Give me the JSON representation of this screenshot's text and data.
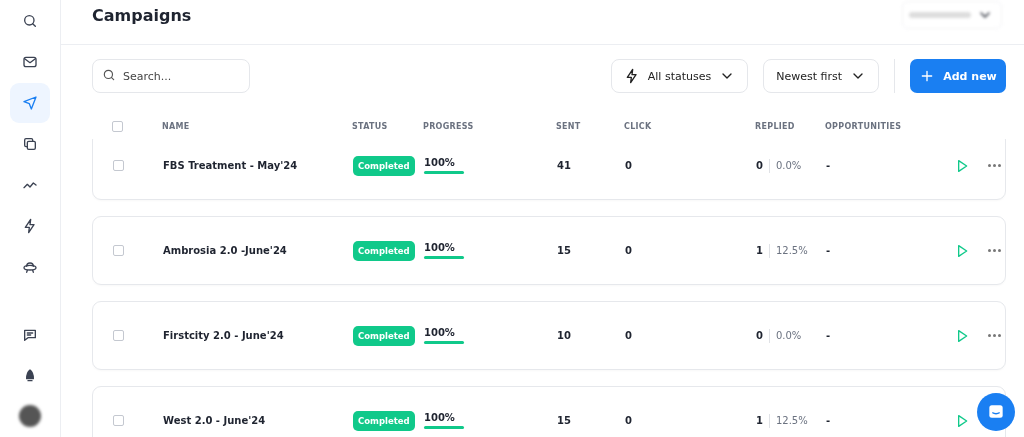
{
  "sidebar": {
    "items": [
      {
        "selected": false
      },
      {
        "selected": false
      },
      {
        "selected": true
      },
      {
        "selected": false
      },
      {
        "selected": false
      },
      {
        "selected": false
      },
      {
        "selected": false
      }
    ]
  },
  "header": {
    "title": "Campaigns"
  },
  "toolbar": {
    "search": {
      "placeholder": "Search..."
    },
    "status_filter": "All statuses",
    "sort": "Newest first",
    "add_button": "Add new"
  },
  "table": {
    "all_checked": false,
    "columns": [
      "NAME",
      "STATUS",
      "PROGRESS",
      "SENT",
      "CLICK",
      "REPLIED",
      "OPPORTUNITIES"
    ],
    "rows": [
      {
        "name": "FBS Treatment - May'24",
        "status": "Completed",
        "progress": "100%",
        "level": 1,
        "sent": "41",
        "click": "0",
        "replied": "0",
        "replied_rate": "0.0%",
        "opportunities": "-",
        "checked": false
      },
      {
        "name": "Ambrosia 2.0 -June'24",
        "status": "Completed",
        "progress": "100%",
        "level": 1,
        "sent": "15",
        "click": "0",
        "replied": "1",
        "replied_rate": "12.5%",
        "opportunities": "-",
        "checked": false
      },
      {
        "name": "Firstcity 2.0 - June'24",
        "status": "Completed",
        "progress": "100%",
        "level": 1,
        "sent": "10",
        "click": "0",
        "replied": "0",
        "replied_rate": "0.0%",
        "opportunities": "-",
        "checked": false
      },
      {
        "name": "West 2.0 - June'24",
        "status": "Completed",
        "progress": "100%",
        "level": 1,
        "sent": "15",
        "click": "0",
        "replied": "1",
        "replied_rate": "12.5%",
        "opportunities": "-",
        "checked": false
      }
    ]
  }
}
